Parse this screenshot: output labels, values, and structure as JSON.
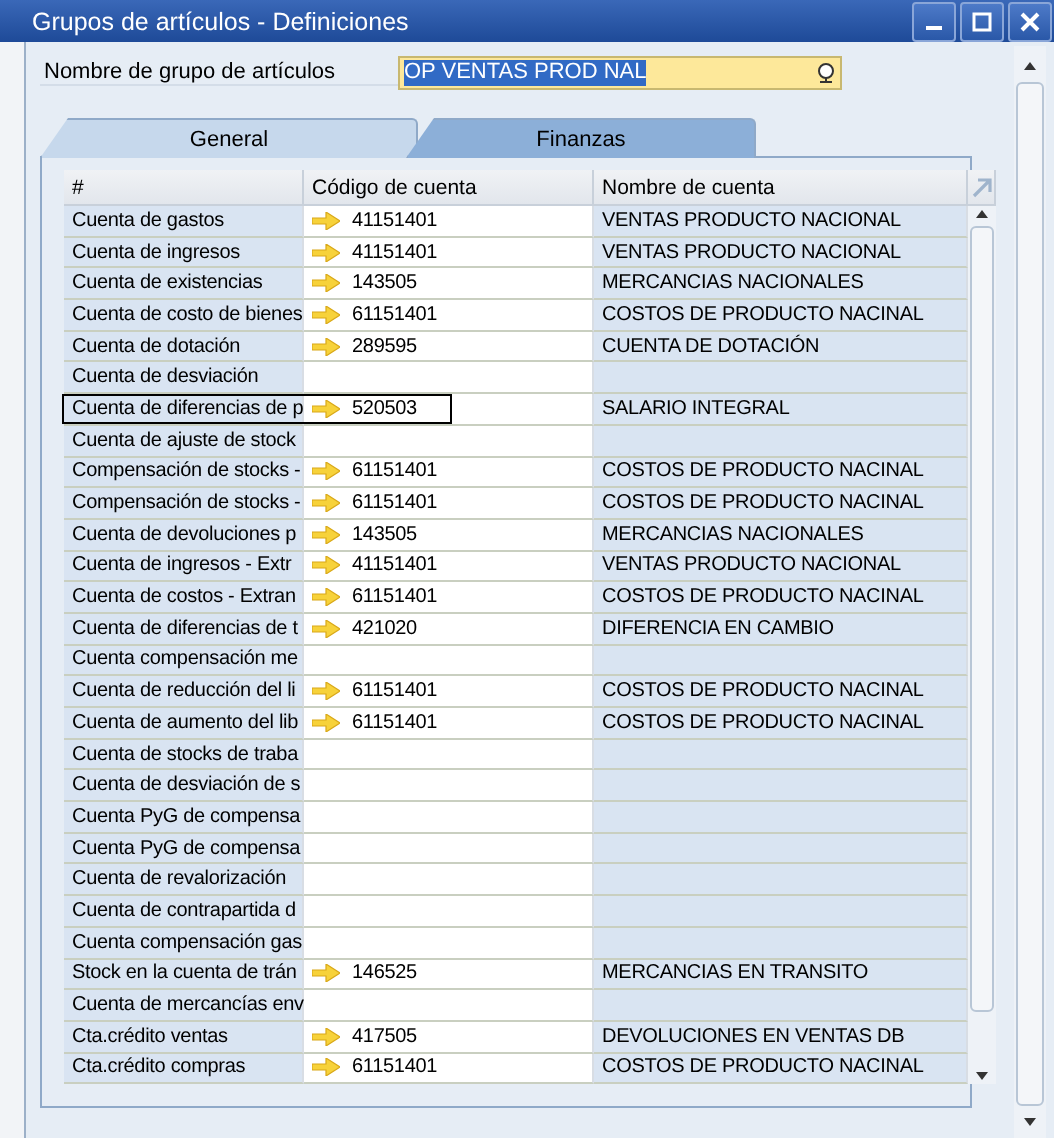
{
  "window": {
    "title": "Grupos de artículos - Definiciones"
  },
  "item_group_name": {
    "label": "Nombre de grupo de artículos",
    "value": "OP VENTAS PROD NAL"
  },
  "tabs": [
    {
      "label": "General",
      "selected": false
    },
    {
      "label": "Finanzas",
      "selected": true
    }
  ],
  "table": {
    "columns": [
      "#",
      "Código de cuenta",
      "Nombre de cuenta"
    ],
    "rows": [
      {
        "account_type": "Cuenta de gastos",
        "code": "41151401",
        "name": "VENTAS PRODUCTO NACIONAL",
        "selected": false
      },
      {
        "account_type": "Cuenta de ingresos",
        "code": "41151401",
        "name": "VENTAS PRODUCTO NACIONAL",
        "selected": false
      },
      {
        "account_type": "Cuenta de existencias",
        "code": "143505",
        "name": "MERCANCIAS NACIONALES",
        "selected": false
      },
      {
        "account_type": "Cuenta de costo de bienes",
        "code": "61151401",
        "name": "COSTOS DE PRODUCTO NACINAL",
        "selected": false
      },
      {
        "account_type": "Cuenta de dotación",
        "code": "289595",
        "name": "CUENTA DE DOTACIÓN",
        "selected": false
      },
      {
        "account_type": "Cuenta de desviación",
        "selected": false
      },
      {
        "account_type": "Cuenta de diferencias de p",
        "code": "520503",
        "name": "SALARIO INTEGRAL",
        "selected": true
      },
      {
        "account_type": "Cuenta de ajuste de stock",
        "selected": false
      },
      {
        "account_type": "Compensación de stocks -",
        "code": "61151401",
        "name": "COSTOS DE PRODUCTO NACINAL",
        "selected": false
      },
      {
        "account_type": "Compensación de stocks -",
        "code": "61151401",
        "name": "COSTOS DE PRODUCTO NACINAL",
        "selected": false
      },
      {
        "account_type": "Cuenta de devoluciones p",
        "code": "143505",
        "name": "MERCANCIAS NACIONALES",
        "selected": false
      },
      {
        "account_type": "Cuenta de ingresos - Extr",
        "code": "41151401",
        "name": "VENTAS PRODUCTO NACIONAL",
        "selected": false
      },
      {
        "account_type": "Cuenta de costos - Extran",
        "code": "61151401",
        "name": "COSTOS DE PRODUCTO NACINAL",
        "selected": false
      },
      {
        "account_type": "Cuenta de diferencias de t",
        "code": "421020",
        "name": "DIFERENCIA EN CAMBIO",
        "selected": false
      },
      {
        "account_type": "Cuenta compensación me",
        "selected": false
      },
      {
        "account_type": "Cuenta de reducción del li",
        "code": "61151401",
        "name": "COSTOS DE PRODUCTO NACINAL",
        "selected": false
      },
      {
        "account_type": "Cuenta de aumento del lib",
        "code": "61151401",
        "name": "COSTOS DE PRODUCTO NACINAL",
        "selected": false
      },
      {
        "account_type": "Cuenta de stocks de traba",
        "selected": false
      },
      {
        "account_type": "Cuenta de desviación de s",
        "selected": false
      },
      {
        "account_type": "Cuenta PyG de compensa",
        "selected": false
      },
      {
        "account_type": "Cuenta PyG de compensa",
        "selected": false
      },
      {
        "account_type": "Cuenta de revalorización",
        "selected": false
      },
      {
        "account_type": "Cuenta de contrapartida d",
        "selected": false
      },
      {
        "account_type": "Cuenta compensación gas",
        "selected": false
      },
      {
        "account_type": "Stock en la cuenta de trán",
        "code": "146525",
        "name": "MERCANCIAS EN TRANSITO",
        "selected": false
      },
      {
        "account_type": "Cuenta de mercancías env",
        "selected": false
      },
      {
        "account_type": "Cta.crédito ventas",
        "code": "417505",
        "name": "DEVOLUCIONES EN VENTAS DB",
        "selected": false
      },
      {
        "account_type": "Cta.crédito compras",
        "code": "61151401",
        "name": "COSTOS DE PRODUCTO NACINAL",
        "selected": false
      }
    ]
  }
}
